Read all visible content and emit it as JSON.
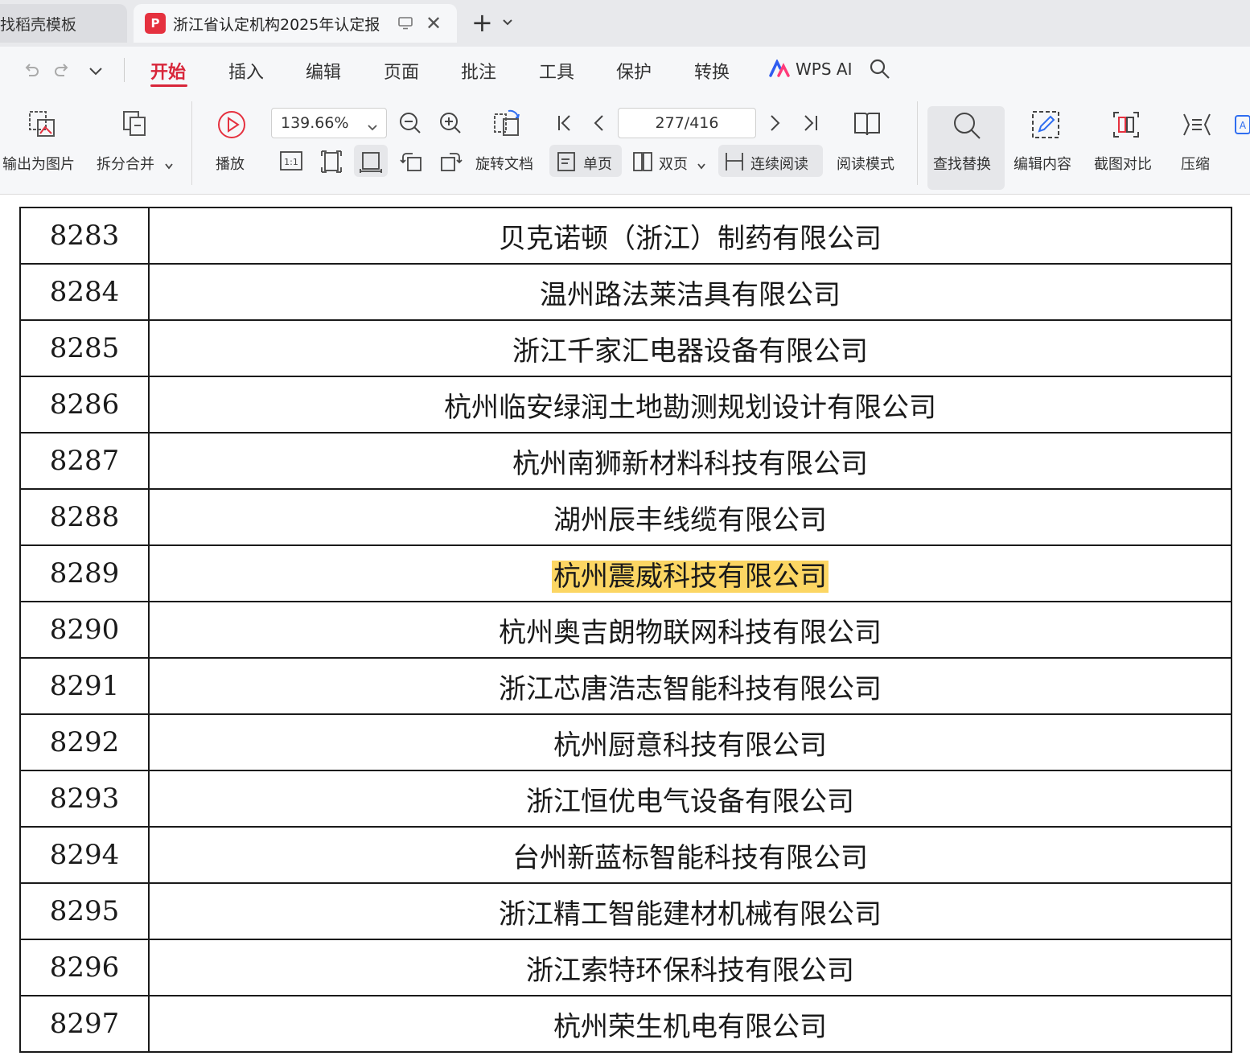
{
  "tabs": {
    "inactive_title": "找稻壳模板",
    "active_icon": "pdf-icon",
    "active_title": "浙江省认定机构2025年认定报",
    "new_tab": "+"
  },
  "menu": {
    "items": [
      "开始",
      "插入",
      "编辑",
      "页面",
      "批注",
      "工具",
      "保护",
      "转换"
    ],
    "active": "开始",
    "ai_label": "WPS AI"
  },
  "toolbar": {
    "export_image": "输出为图片",
    "split_merge": "拆分合并",
    "play": "播放",
    "zoom_value": "139.66%",
    "actual_size_icon": "1:1",
    "rotate_doc": "旋转文档",
    "single_page": "单页",
    "double_page": "双页",
    "continuous": "连续阅读",
    "page_value": "277/416",
    "read_mode": "阅读模式",
    "find_replace": "查找替换",
    "edit_content": "编辑内容",
    "screenshot_compare": "截图对比",
    "compress": "压缩"
  },
  "table": {
    "rows": [
      {
        "num": "8283",
        "name": "贝克诺顿（浙江）制药有限公司"
      },
      {
        "num": "8284",
        "name": "温州路法莱洁具有限公司"
      },
      {
        "num": "8285",
        "name": "浙江千家汇电器设备有限公司"
      },
      {
        "num": "8286",
        "name": "杭州临安绿润土地勘测规划设计有限公司"
      },
      {
        "num": "8287",
        "name": "杭州南狮新材料科技有限公司"
      },
      {
        "num": "8288",
        "name": "湖州辰丰线缆有限公司"
      },
      {
        "num": "8289",
        "name": "杭州震威科技有限公司"
      },
      {
        "num": "8290",
        "name": "杭州奥吉朗物联网科技有限公司"
      },
      {
        "num": "8291",
        "name": "浙江芯唐浩志智能科技有限公司"
      },
      {
        "num": "8292",
        "name": "杭州厨意科技有限公司"
      },
      {
        "num": "8293",
        "name": "浙江恒优电气设备有限公司"
      },
      {
        "num": "8294",
        "name": "台州新蓝标智能科技有限公司"
      },
      {
        "num": "8295",
        "name": "浙江精工智能建材机械有限公司"
      },
      {
        "num": "8296",
        "name": "浙江索特环保科技有限公司"
      },
      {
        "num": "8297",
        "name": "杭州荣生机电有限公司"
      }
    ],
    "highlight_color": "#fcd663"
  },
  "colors": {
    "accent": "#d8263a",
    "pdf_icon": "#e5313f"
  }
}
